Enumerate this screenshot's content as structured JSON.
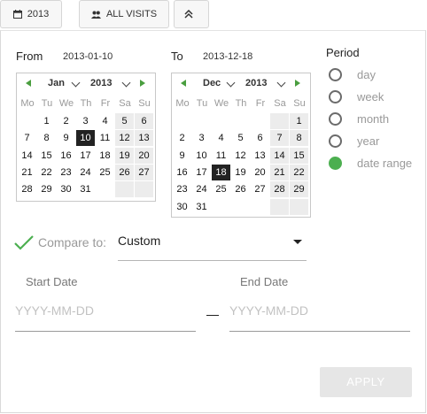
{
  "toolbar": {
    "date_label": "2013",
    "segment_label": "ALL VISITS"
  },
  "range": {
    "from_label": "From",
    "from_value": "2013-01-10",
    "to_label": "To",
    "to_value": "2013-12-18"
  },
  "weekdays": [
    "Mo",
    "Tu",
    "We",
    "Th",
    "Fr",
    "Sa",
    "Su"
  ],
  "calendars": [
    {
      "month": "Jan",
      "year": "2013",
      "rows": [
        [
          "",
          "",
          "1",
          "2",
          "3",
          "4",
          "5",
          "6"
        ],
        [
          "",
          "7",
          "8",
          "9",
          "10",
          "11",
          "12",
          "13"
        ],
        [
          "",
          "14",
          "15",
          "16",
          "17",
          "18",
          "19",
          "20"
        ],
        [
          "",
          "21",
          "22",
          "23",
          "24",
          "25",
          "26",
          "27"
        ],
        [
          "",
          "28",
          "29",
          "30",
          "31",
          "",
          "",
          ""
        ]
      ],
      "selected_day": "10"
    },
    {
      "month": "Dec",
      "year": "2013",
      "rows": [
        [
          "",
          "",
          "",
          "",
          "",
          "",
          "",
          "1"
        ],
        [
          "",
          "2",
          "3",
          "4",
          "5",
          "6",
          "7",
          "8"
        ],
        [
          "",
          "9",
          "10",
          "11",
          "12",
          "13",
          "14",
          "15"
        ],
        [
          "",
          "16",
          "17",
          "18",
          "19",
          "20",
          "21",
          "22"
        ],
        [
          "",
          "23",
          "24",
          "25",
          "26",
          "27",
          "28",
          "29"
        ],
        [
          "",
          "30",
          "31",
          "",
          "",
          "",
          "",
          ""
        ]
      ],
      "selected_day": "18"
    }
  ],
  "period": {
    "title": "Period",
    "options": [
      "day",
      "week",
      "month",
      "year",
      "date range"
    ],
    "selected": "date range",
    "selected_color": "#4caf50"
  },
  "compare": {
    "label": "Compare to:",
    "value": "Custom",
    "checked": true,
    "check_color": "#4caf50"
  },
  "custom_range": {
    "start_label": "Start Date",
    "start_placeholder": "YYYY-MM-DD",
    "end_label": "End Date",
    "end_placeholder": "YYYY-MM-DD"
  },
  "apply_label": "APPLY"
}
